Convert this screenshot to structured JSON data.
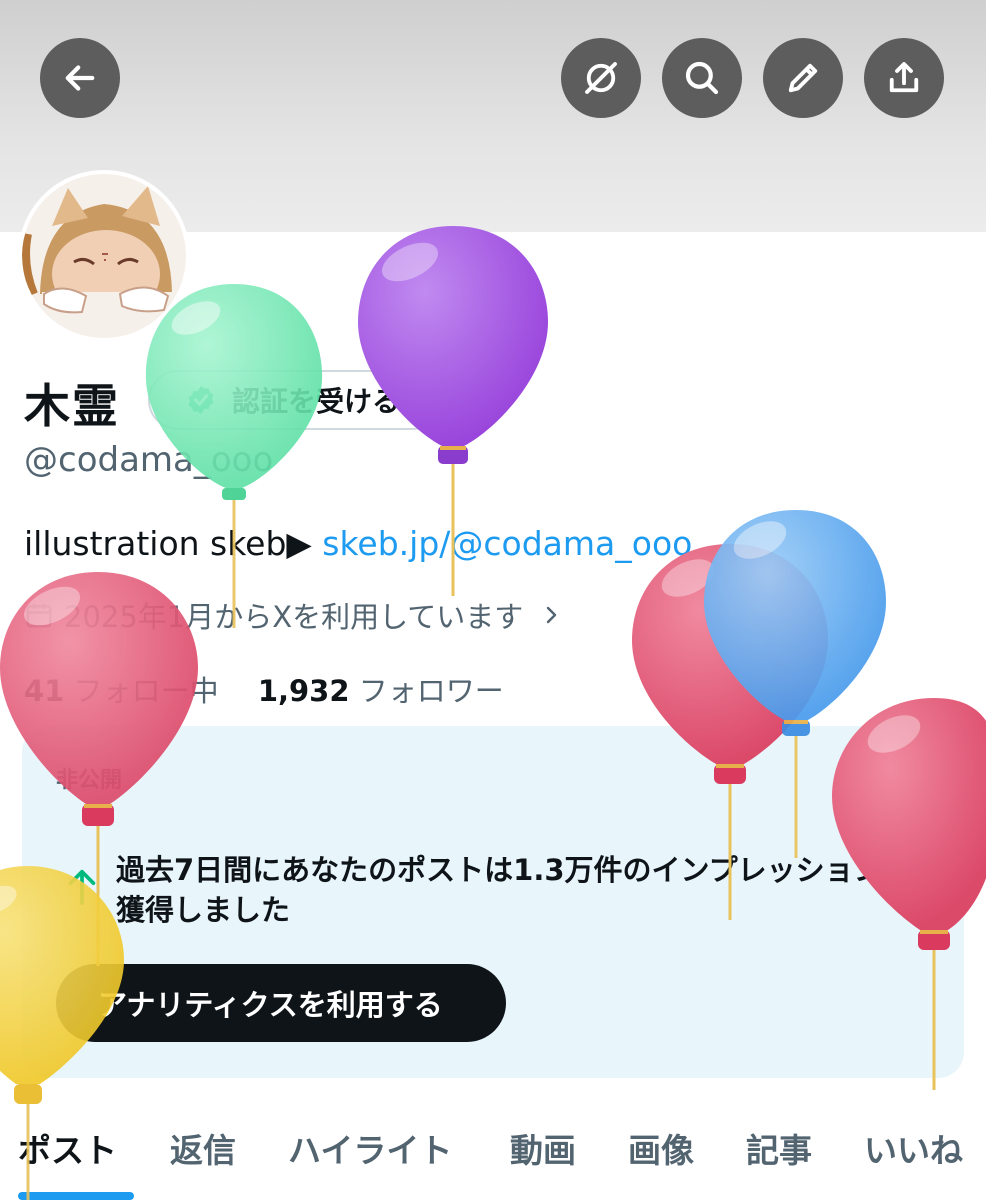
{
  "header": {
    "back_icon": "arrow-left-icon",
    "grok_icon": "grok-icon",
    "search_icon": "search-icon",
    "edit_icon": "pencil-icon",
    "share_icon": "share-icon",
    "button_color": "#5d5d5d"
  },
  "profile": {
    "display_name": "木霊",
    "verify_label": "認証を受ける",
    "handle": "@codama_ooo",
    "bio_text": "illustration skeb▶ ",
    "bio_link": "skeb.jp/@codama_ooo",
    "joined": "2025年1月からXを利用しています",
    "following_count": "41",
    "following_label": "フォロー中",
    "followers_count": "1,932",
    "followers_label": "フォロワー"
  },
  "analytics_card": {
    "visibility": "非公開",
    "message": "過去7日間にあなたのポストは1.3万件のインプレッションを獲得しました",
    "button_label": "アナリティクスを利用する",
    "background": "#e8f6fc"
  },
  "tabs": [
    {
      "label": "ポスト",
      "active": true
    },
    {
      "label": "返信"
    },
    {
      "label": "ハイライト"
    },
    {
      "label": "動画"
    },
    {
      "label": "画像"
    },
    {
      "label": "記事"
    },
    {
      "label": "いいね"
    }
  ],
  "colors": {
    "accent": "#1d9bf0",
    "balloon_green": "#6ee6b0",
    "balloon_purple": "#a052e0",
    "balloon_red": "#e0506e",
    "balloon_blue": "#5aa8f0",
    "balloon_yellow": "#f2cf3a"
  }
}
